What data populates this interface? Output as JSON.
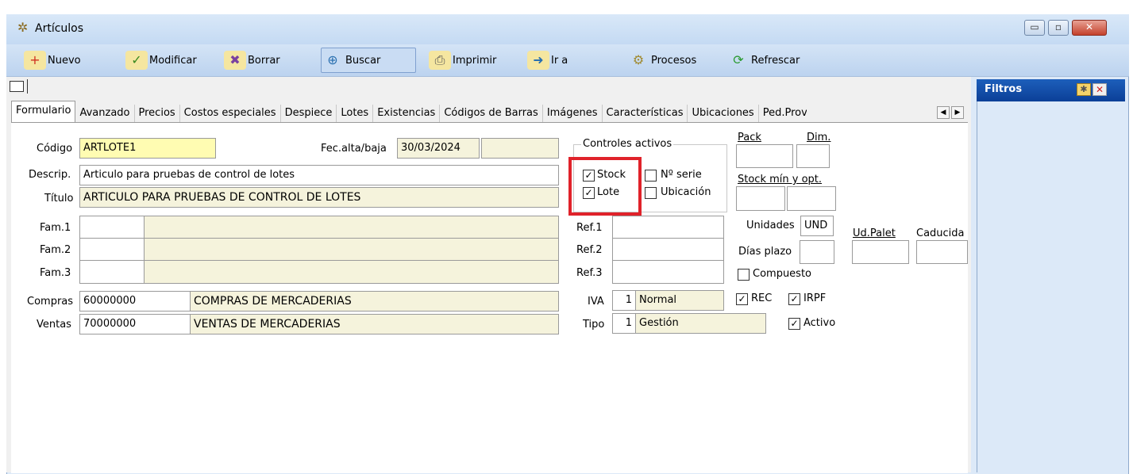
{
  "window": {
    "title": "Artículos"
  },
  "toolbar": {
    "nuevo": "Nuevo",
    "modificar": "Modificar",
    "borrar": "Borrar",
    "buscar": "Buscar",
    "imprimir": "Imprimir",
    "ir_a": "Ir a",
    "procesos": "Procesos",
    "refrescar": "Refrescar"
  },
  "tabs": [
    "Formulario",
    "Avanzado",
    "Precios",
    "Costos especiales",
    "Despiece",
    "Lotes",
    "Existencias",
    "Códigos de Barras",
    "Imágenes",
    "Características",
    "Ubicaciones",
    "Ped.Prove"
  ],
  "filters": {
    "title": "Filtros"
  },
  "form": {
    "codigo_label": "Código",
    "codigo": "ARTLOTE1",
    "fec_label": "Fec.alta/baja",
    "fec_alta": "30/03/2024",
    "fec_baja": "",
    "descrip_label": "Descrip.",
    "descrip": "Articulo para pruebas de control de lotes",
    "titulo_label": "Título",
    "titulo": "ARTICULO PARA PRUEBAS DE CONTROL DE LOTES",
    "fam1_label": "Fam.1",
    "fam2_label": "Fam.2",
    "fam3_label": "Fam.3",
    "compras_label": "Compras",
    "compras_cuenta": "60000000",
    "compras_desc": "COMPRAS DE MERCADERIAS",
    "ventas_label": "Ventas",
    "ventas_cuenta": "70000000",
    "ventas_desc": "VENTAS DE MERCADERIAS",
    "controles_label": "Controles activos",
    "stock_label": "Stock",
    "stock_checked": true,
    "lote_label": "Lote",
    "lote_checked": true,
    "nserie_label": "Nº serie",
    "nserie_checked": false,
    "ubicacion_label": "Ubicación",
    "ubicacion_checked": false,
    "pack_label": "Pack",
    "dim_label": "Dim.",
    "stock_min_label": "Stock mín y opt.",
    "ref1_label": "Ref.1",
    "ref2_label": "Ref.2",
    "ref3_label": "Ref.3",
    "unidades_label": "Unidades",
    "unidades": "UND",
    "ud_palet_label": "Ud.Palet",
    "caducidad_label": "Caducida",
    "dias_plazo_label": "Días plazo",
    "compuesto_label": "Compuesto",
    "iva_label": "IVA",
    "iva_code": "1",
    "iva_desc": "Normal",
    "rec_label": "REC",
    "irpf_label": "IRPF",
    "tipo_label": "Tipo",
    "tipo_code": "1",
    "tipo_desc": "Gestión",
    "activo_label": "Activo"
  },
  "colors": {
    "highlight": "#e0222a",
    "field_bg": "#f5f3dc",
    "code_bg": "#fffcb2"
  }
}
